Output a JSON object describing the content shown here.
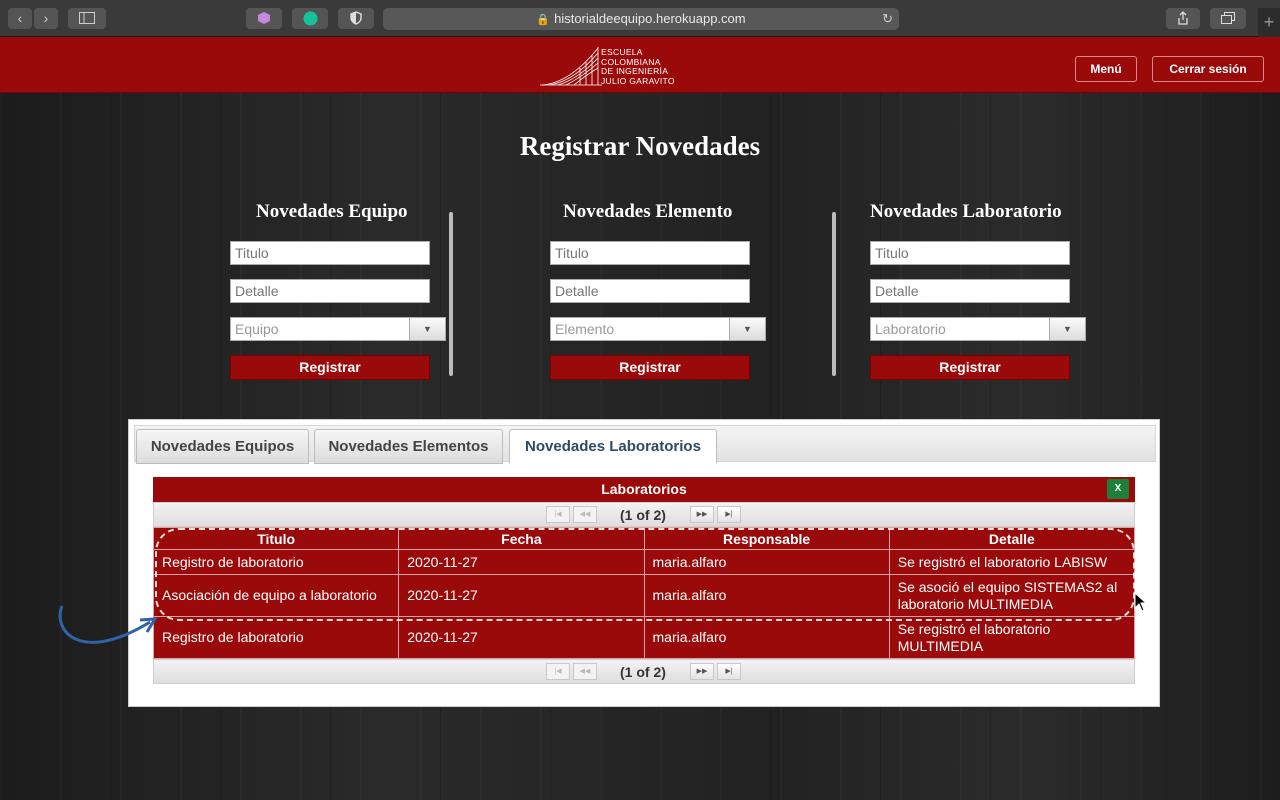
{
  "browser": {
    "url": "historialdeequipo.herokuapp.com",
    "back_glyph": "‹",
    "forward_glyph": "›",
    "new_tab_glyph": "+"
  },
  "header": {
    "logo_lines": [
      "ESCUELA",
      "COLOMBIANA",
      "DE INGENIERÍA",
      "JULIO GARAVITO"
    ],
    "menu_label": "Menú",
    "logout_label": "Cerrar sesión",
    "brand_color": "#9b0a0a"
  },
  "page": {
    "title": "Registrar Novedades"
  },
  "forms": [
    {
      "heading": "Novedades Equipo",
      "titulo_placeholder": "Titulo",
      "detalle_placeholder": "Detalle",
      "select_placeholder": "Equipo",
      "button": "Registrar"
    },
    {
      "heading": "Novedades Elemento",
      "titulo_placeholder": "Titulo",
      "detalle_placeholder": "Detalle",
      "select_placeholder": "Elemento",
      "button": "Registrar"
    },
    {
      "heading": "Novedades Laboratorio",
      "titulo_placeholder": "Titulo",
      "detalle_placeholder": "Detalle",
      "select_placeholder": "Laboratorio",
      "button": "Registrar"
    }
  ],
  "tabs": [
    {
      "label": "Novedades Equipos",
      "active": false
    },
    {
      "label": "Novedades Elementos",
      "active": false
    },
    {
      "label": "Novedades Laboratorios",
      "active": true
    }
  ],
  "table": {
    "caption": "Laboratorios",
    "excel_icon": "X",
    "pager_text": "(1 of 2)",
    "columns": [
      "Titulo",
      "Fecha",
      "Responsable",
      "Detalle"
    ],
    "rows": [
      [
        "Registro de laboratorio",
        "2020-11-27",
        "maria.alfaro",
        "Se registró el laboratorio LABISW"
      ],
      [
        "Asociación de equipo a laboratorio",
        "2020-11-27",
        "maria.alfaro",
        "Se asoció el equipo SISTEMAS2 al laboratorio MULTIMEDIA"
      ],
      [
        "Registro de laboratorio",
        "2020-11-27",
        "maria.alfaro",
        "Se registró el laboratorio MULTIMEDIA"
      ]
    ]
  }
}
